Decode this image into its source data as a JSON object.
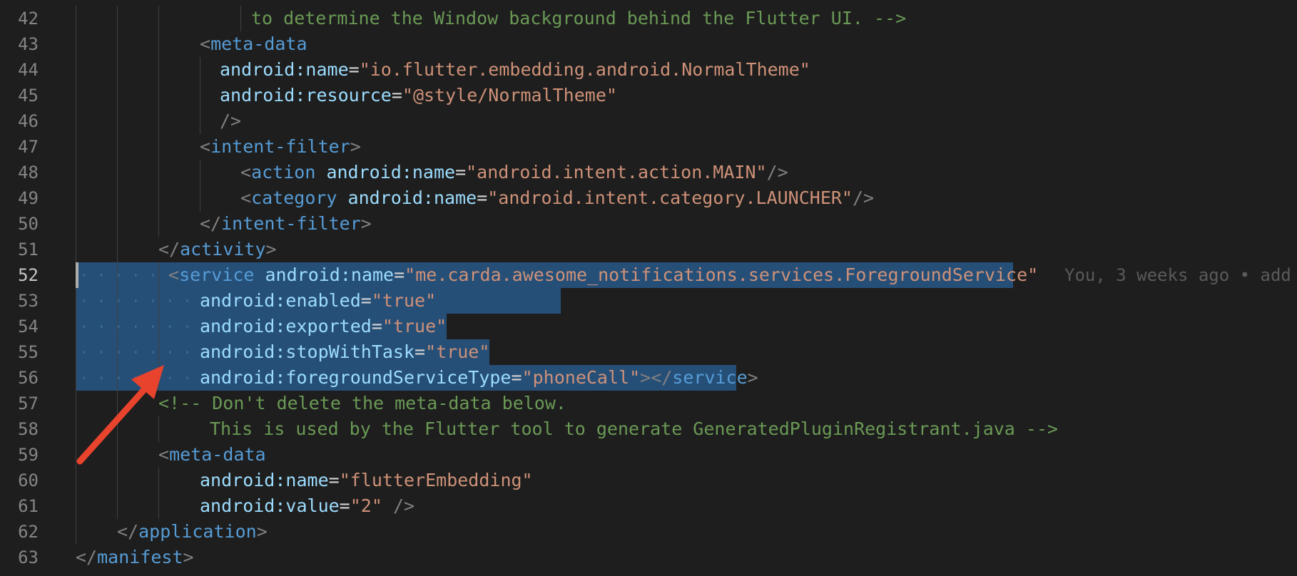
{
  "editor": {
    "lines": [
      {
        "num": "42",
        "tokens": [
          {
            "t": "to determine the Window background behind the Flutter UI. -->",
            "c": "comment"
          }
        ]
      },
      {
        "num": "43",
        "tokens": [
          {
            "t": "<",
            "c": "tag-bracket"
          },
          {
            "t": "meta-data",
            "c": "tag-name"
          }
        ]
      },
      {
        "num": "44",
        "tokens": [
          {
            "t": "android:name",
            "c": "attr-name"
          },
          {
            "t": "=",
            "c": "punct"
          },
          {
            "t": "\"io.flutter.embedding.android.NormalTheme\"",
            "c": "attr-value"
          }
        ]
      },
      {
        "num": "45",
        "tokens": [
          {
            "t": "android:resource",
            "c": "attr-name"
          },
          {
            "t": "=",
            "c": "punct"
          },
          {
            "t": "\"@style/NormalTheme\"",
            "c": "attr-value"
          }
        ]
      },
      {
        "num": "46",
        "tokens": [
          {
            "t": "/>",
            "c": "tag-bracket"
          }
        ]
      },
      {
        "num": "47",
        "tokens": [
          {
            "t": "<",
            "c": "tag-bracket"
          },
          {
            "t": "intent-filter",
            "c": "tag-name"
          },
          {
            "t": ">",
            "c": "tag-bracket"
          }
        ]
      },
      {
        "num": "48",
        "tokens": [
          {
            "t": "<",
            "c": "tag-bracket"
          },
          {
            "t": "action",
            "c": "tag-name"
          },
          {
            "t": " ",
            "c": "punct"
          },
          {
            "t": "android:name",
            "c": "attr-name"
          },
          {
            "t": "=",
            "c": "punct"
          },
          {
            "t": "\"android.intent.action.MAIN\"",
            "c": "attr-value"
          },
          {
            "t": "/>",
            "c": "tag-bracket"
          }
        ]
      },
      {
        "num": "49",
        "tokens": [
          {
            "t": "<",
            "c": "tag-bracket"
          },
          {
            "t": "category",
            "c": "tag-name"
          },
          {
            "t": " ",
            "c": "punct"
          },
          {
            "t": "android:name",
            "c": "attr-name"
          },
          {
            "t": "=",
            "c": "punct"
          },
          {
            "t": "\"android.intent.category.LAUNCHER\"",
            "c": "attr-value"
          },
          {
            "t": "/>",
            "c": "tag-bracket"
          }
        ]
      },
      {
        "num": "50",
        "tokens": [
          {
            "t": "</",
            "c": "tag-bracket"
          },
          {
            "t": "intent-filter",
            "c": "tag-name"
          },
          {
            "t": ">",
            "c": "tag-bracket"
          }
        ]
      },
      {
        "num": "51",
        "tokens": [
          {
            "t": "</",
            "c": "tag-bracket"
          },
          {
            "t": "activity",
            "c": "tag-name"
          },
          {
            "t": ">",
            "c": "tag-bracket"
          }
        ]
      },
      {
        "num": "52",
        "tokens": [
          {
            "t": "<",
            "c": "tag-bracket"
          },
          {
            "t": "service",
            "c": "tag-name"
          },
          {
            "t": " ",
            "c": "punct"
          },
          {
            "t": "android:name",
            "c": "attr-name"
          },
          {
            "t": "=",
            "c": "punct"
          },
          {
            "t": "\"me.carda.awesome_notifications.services.ForegroundService\"",
            "c": "attr-value"
          }
        ]
      },
      {
        "num": "53",
        "tokens": [
          {
            "t": "android:enabled",
            "c": "attr-name"
          },
          {
            "t": "=",
            "c": "punct"
          },
          {
            "t": "\"true\"",
            "c": "attr-value"
          }
        ]
      },
      {
        "num": "54",
        "tokens": [
          {
            "t": "android:exported",
            "c": "attr-name"
          },
          {
            "t": "=",
            "c": "punct"
          },
          {
            "t": "\"true\"",
            "c": "attr-value"
          }
        ]
      },
      {
        "num": "55",
        "tokens": [
          {
            "t": "android:stopWithTask",
            "c": "attr-name"
          },
          {
            "t": "=",
            "c": "punct"
          },
          {
            "t": "\"true\"",
            "c": "attr-value"
          }
        ]
      },
      {
        "num": "56",
        "tokens": [
          {
            "t": "android:foregroundServiceType",
            "c": "attr-name"
          },
          {
            "t": "=",
            "c": "punct"
          },
          {
            "t": "\"phoneCall\"",
            "c": "attr-value"
          },
          {
            "t": "></",
            "c": "tag-bracket"
          },
          {
            "t": "service",
            "c": "tag-name"
          },
          {
            "t": ">",
            "c": "tag-bracket"
          }
        ]
      },
      {
        "num": "57",
        "tokens": [
          {
            "t": "<!-- Don't delete the meta-data below.",
            "c": "comment"
          }
        ]
      },
      {
        "num": "58",
        "tokens": [
          {
            "t": "This is used by the Flutter tool to generate GeneratedPluginRegistrant.java -->",
            "c": "comment"
          }
        ]
      },
      {
        "num": "59",
        "tokens": [
          {
            "t": "<",
            "c": "tag-bracket"
          },
          {
            "t": "meta-data",
            "c": "tag-name"
          }
        ]
      },
      {
        "num": "60",
        "tokens": [
          {
            "t": "android:name",
            "c": "attr-name"
          },
          {
            "t": "=",
            "c": "punct"
          },
          {
            "t": "\"flutterEmbedding\"",
            "c": "attr-value"
          }
        ]
      },
      {
        "num": "61",
        "tokens": [
          {
            "t": "android:value",
            "c": "attr-name"
          },
          {
            "t": "=",
            "c": "punct"
          },
          {
            "t": "\"2\"",
            "c": "attr-value"
          },
          {
            "t": " />",
            "c": "tag-bracket"
          }
        ]
      },
      {
        "num": "62",
        "tokens": [
          {
            "t": "</",
            "c": "tag-bracket"
          },
          {
            "t": "application",
            "c": "tag-name"
          },
          {
            "t": ">",
            "c": "tag-bracket"
          }
        ]
      },
      {
        "num": "63",
        "tokens": [
          {
            "t": "</",
            "c": "tag-bracket"
          },
          {
            "t": "manifest",
            "c": "tag-name"
          },
          {
            "t": ">",
            "c": "tag-bracket"
          }
        ]
      }
    ],
    "blame": "You, 3 weeks ago • add",
    "active_line": "52"
  },
  "colors": {
    "background": "#1e1e1e",
    "selection": "#264f78",
    "arrow": "#e8432d"
  }
}
